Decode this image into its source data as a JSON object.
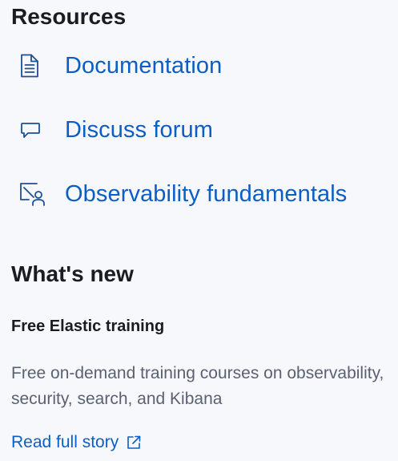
{
  "resources": {
    "title": "Resources",
    "links": [
      {
        "label": "Documentation",
        "icon": "document-icon"
      },
      {
        "label": "Discuss forum",
        "icon": "chat-icon"
      },
      {
        "label": "Observability fundamentals",
        "icon": "training-icon"
      }
    ]
  },
  "whats_new": {
    "title": "What's new",
    "item": {
      "title": "Free Elastic training",
      "description": "Free on-demand training courses on observability, security, search, and Kibana",
      "link_label": "Read full story",
      "link_icon": "external-link-icon"
    }
  },
  "colors": {
    "background": "#f7f8fc",
    "link": "#0b5fc4",
    "icon": "#1d4f96",
    "heading": "#1a1c21",
    "body_text": "#5a6170"
  }
}
